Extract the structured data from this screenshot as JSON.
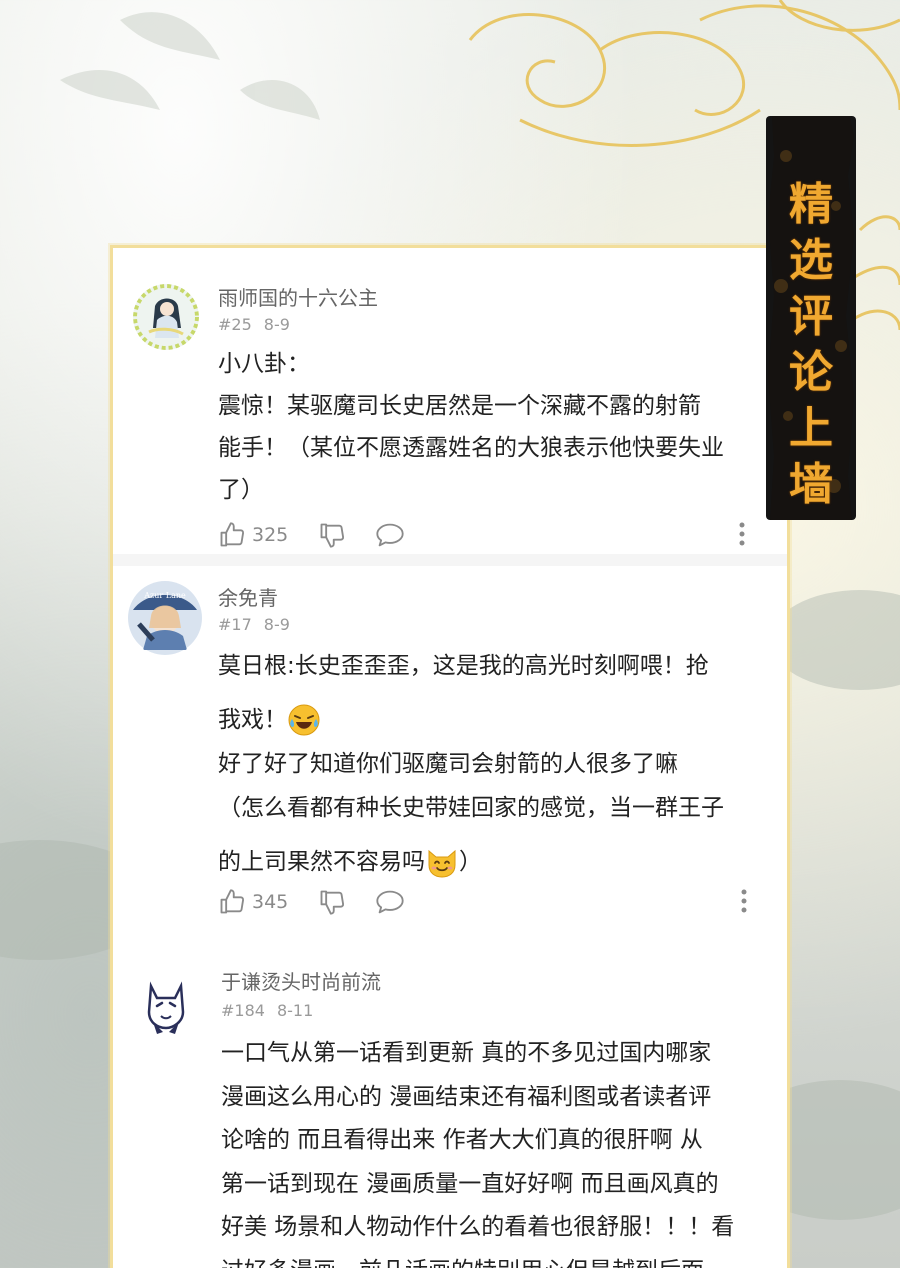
{
  "banner": {
    "chars": [
      "精",
      "选",
      "评",
      "论",
      "上",
      "墙"
    ]
  },
  "comments": [
    {
      "username": "雨师国的十六公主",
      "floor": "#25",
      "date": "8-9",
      "lines": [
        "小八卦：",
        "震惊！某驱魔司长史居然是一个深藏不露的射箭",
        "能手！（某位不愿透露姓名的大狼表示他快要失业",
        "了）"
      ],
      "likes": "325",
      "avatar_icon": "girl-portrait-avatar"
    },
    {
      "username": "余免青",
      "floor": "#17",
      "date": "8-9",
      "lines": [
        "莫日根:长史歪歪歪，这是我的高光时刻啊喂！抢",
        "我戏！",
        "好了好了知道你们驱魔司会射箭的人很多了嘛",
        "（怎么看都有种长史带娃回家的感觉，当一群王子",
        "的上司果然不容易吗",
        "）"
      ],
      "likes": "345",
      "avatar_icon": "anime-character-avatar",
      "avatar_text": "Azur Lane"
    },
    {
      "username": "于谦烫头时尚前流",
      "floor": "#184",
      "date": "8-11",
      "lines": [
        "一口气从第一话看到更新 真的不多见过国内哪家",
        "漫画这么用心的 漫画结束还有福利图或者读者评",
        "论啥的 而且看得出来 作者大大们真的很肝啊 从",
        "第一话到现在 漫画质量一直好好啊 而且画风真的",
        "好美 场景和人物动作什么的看着也很舒服！！！看",
        "过好多漫画，前几话画的特别用心但是越到后面"
      ],
      "avatar_icon": "cartoon-cat-avatar"
    }
  ],
  "icons": {
    "like": "thumbs-up-icon",
    "dislike": "thumbs-down-icon",
    "reply": "chat-bubble-icon",
    "more": "more-vertical-icon",
    "emoji_laugh": "laughing-tears-emoji-icon",
    "emoji_cat": "smiling-cat-emoji-icon"
  },
  "colors": {
    "banner_text": "#f0a830",
    "panel_border": "#f2de9b",
    "username": "#666666",
    "meta": "#9a9a9a"
  }
}
